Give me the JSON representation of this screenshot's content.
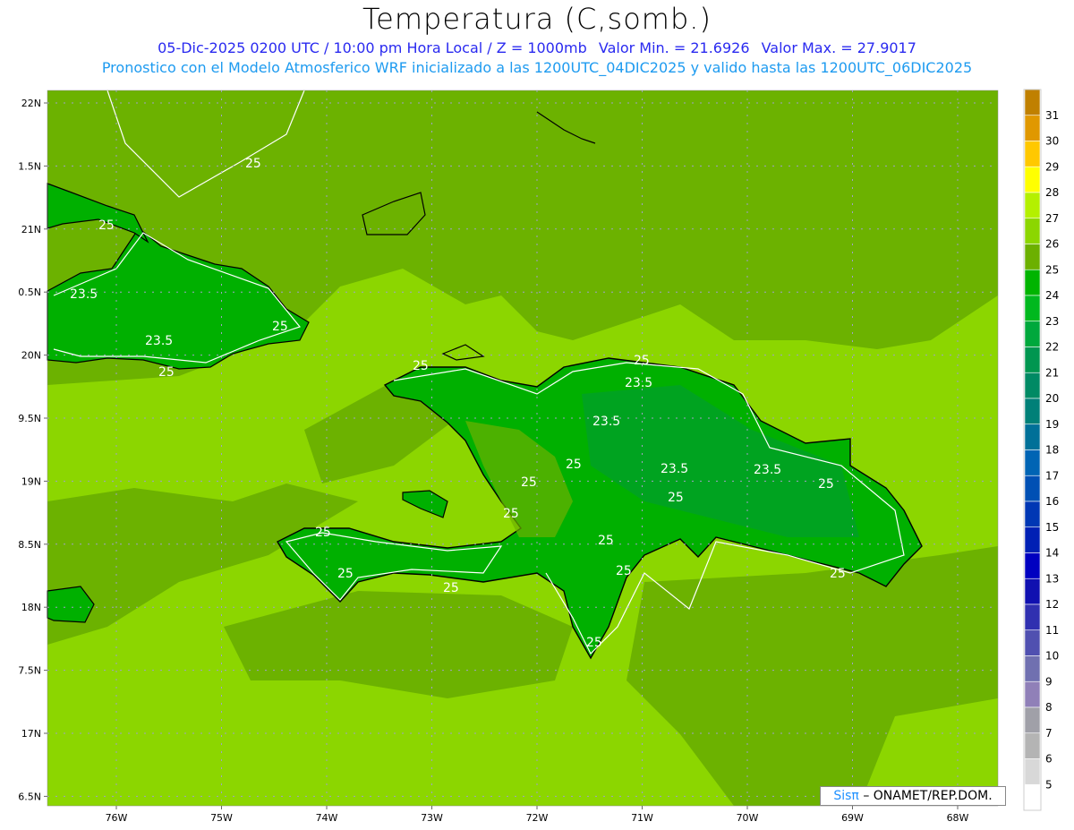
{
  "header": {
    "title": "Temperatura (C,somb.)",
    "line1": {
      "datetime": "05-Dic-2025 0200 UTC / 10:00 pm Hora Local / Z = 1000mb",
      "min": "Valor Min. = 21.6926",
      "max": "Valor Max. = 27.9017"
    },
    "line2": "Pronostico con el Modelo Atmosferico WRF inicializado a las 1200UTC_04DIC2025 y valido hasta las  1200UTC_06DIC2025"
  },
  "map": {
    "lon_labels": [
      "76W",
      "75W",
      "74W",
      "73W",
      "72W",
      "71W",
      "70W",
      "69W",
      "68W"
    ],
    "lat_labels": [
      "22N",
      "1.5N",
      "21N",
      "0.5N",
      "20N",
      "9.5N",
      "19N",
      "8.5N",
      "18N",
      "7.5N",
      "17N",
      "6.5N"
    ],
    "contour_labels": [
      "25",
      "25",
      "23.5",
      "23.5",
      "25",
      "25",
      "25",
      "25",
      "23.5",
      "23.5",
      "23.5",
      "23.5",
      "25",
      "25",
      "25",
      "25",
      "25",
      "25",
      "25",
      "25",
      "25",
      "25",
      "25",
      "25"
    ],
    "colors": {
      "sea_light": "#8cd600",
      "sea_mid": "#6cb200",
      "land": "#00b000",
      "land_dark": "#00a028"
    }
  },
  "colorbar": {
    "labels": [
      "31",
      "30",
      "29",
      "28",
      "27",
      "26",
      "25",
      "24",
      "23",
      "22",
      "21",
      "20",
      "19",
      "18",
      "17",
      "16",
      "15",
      "14",
      "13",
      "12",
      "11",
      "10",
      "9",
      "8",
      "7",
      "6",
      "5"
    ],
    "colors": [
      "#c08000",
      "#e09800",
      "#ffc800",
      "#ffff00",
      "#b4f000",
      "#8cd600",
      "#6cb000",
      "#00b400",
      "#00b81e",
      "#00a83c",
      "#009650",
      "#008a64",
      "#008078",
      "#007098",
      "#0064b4",
      "#0050b4",
      "#0037b4",
      "#0020b4",
      "#0000c0",
      "#1010b0",
      "#3030b0",
      "#5050b0",
      "#7070b0",
      "#9080b8",
      "#a0a0a8",
      "#b4b4b4",
      "#d8d8d8",
      "#ffffff"
    ]
  },
  "credit": {
    "logo": "Sisπ",
    "text": "– ONAMET/REP.DOM."
  }
}
